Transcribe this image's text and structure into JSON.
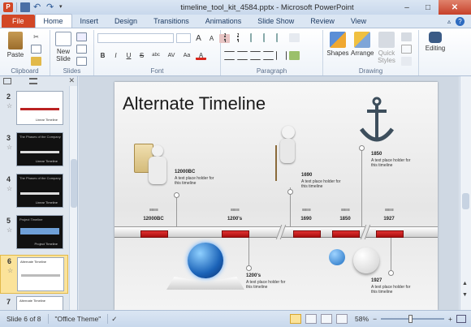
{
  "window": {
    "title": "timeline_tool_kit_4584.pptx - Microsoft PowerPoint",
    "minimize": "–",
    "maximize": "□",
    "close": "✕",
    "help": "?"
  },
  "tabs": [
    "File",
    "Home",
    "Insert",
    "Design",
    "Transitions",
    "Animations",
    "Slide Show",
    "Review",
    "View"
  ],
  "ribbon": {
    "clipboard": {
      "paste": "Paste",
      "label": "Clipboard"
    },
    "slides": {
      "new_slide": "New Slide",
      "label": "Slides"
    },
    "font": {
      "label": "Font",
      "bold": "B",
      "italic": "I",
      "underline": "U",
      "strike": "S",
      "shadow": "abc",
      "spacing": "AV",
      "case": "Aa",
      "grow": "A",
      "shrink": "A",
      "color": "A"
    },
    "paragraph": {
      "label": "Paragraph"
    },
    "drawing": {
      "shapes": "Shapes",
      "arrange": "Arrange",
      "quick_styles": "Quick Styles",
      "label": "Drawing"
    },
    "editing": {
      "editing": "Editing"
    }
  },
  "slides_panel": {
    "items": [
      {
        "num": "2",
        "caption": "Linear Timeline"
      },
      {
        "num": "3",
        "caption": "The Phases of the Company",
        "sub": "Linear Timeline"
      },
      {
        "num": "4",
        "caption": "The Phases of the Company",
        "sub": "Linear Timeline"
      },
      {
        "num": "5",
        "caption": "Project Timeline",
        "sub": "Project Timeline"
      },
      {
        "num": "6",
        "caption": "Alternate Timeline"
      },
      {
        "num": "7",
        "caption": "Alternate Timeline"
      }
    ]
  },
  "slide": {
    "title": "Alternate Timeline",
    "ticks": "ıııııııııııı",
    "events": [
      {
        "year": "12000BC",
        "label": "12000BC",
        "text": "A text place holder for this timeline"
      },
      {
        "year": "1200's",
        "label": "1200's",
        "text": "A text place holder for this timeline"
      },
      {
        "year": "1690",
        "label": "1690",
        "text": "A text place holder for this timeline"
      },
      {
        "year": "1850",
        "label": "1850",
        "text": "A text place holder for this timeline"
      },
      {
        "year": "1927",
        "label": "1927",
        "text": "A text place holder for this timeline"
      }
    ]
  },
  "status": {
    "slide": "Slide 6 of 8",
    "theme": "\"Office Theme\"",
    "zoom": "58%",
    "zoom_minus": "−",
    "zoom_plus": "+"
  }
}
